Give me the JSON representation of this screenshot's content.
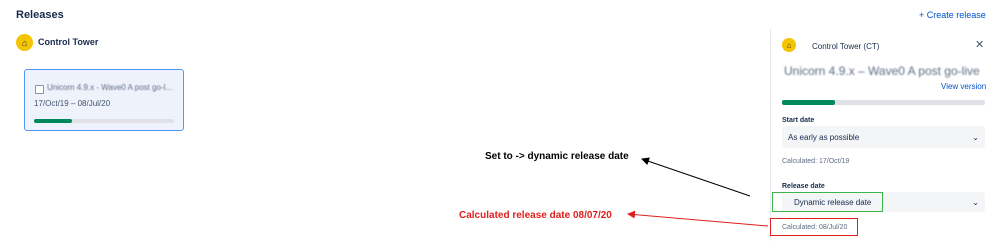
{
  "header": {
    "title": "Releases",
    "create_label": "+ Create release"
  },
  "project": {
    "name": "Control Tower"
  },
  "release_card": {
    "name": "Unicorn 4.9.x - Wave0 A post go-l...",
    "dates": "17/Oct/19 – 08/Jul/20",
    "progress": 0.27
  },
  "panel": {
    "project": "Control Tower (CT)",
    "release_name": "Unicorn 4.9.x – Wave0 A post go-live",
    "view_version": "View version",
    "progress": 0.26,
    "start_date": {
      "label": "Start date",
      "value": "As early as possible",
      "calculated": "Calculated: 17/Oct/19"
    },
    "release_date": {
      "label": "Release date",
      "value": "Dynamic release date",
      "calculated": "Calculated: 08/Jul/20"
    }
  },
  "annotations": {
    "set_to": "Set to -> dynamic release date",
    "calculated": "Calculated release date 08/07/20"
  },
  "colors": {
    "accent": "#0052cc",
    "progress": "#00875a",
    "annotation_red": "#e01e1e",
    "annotation_green": "#3cb54a"
  }
}
